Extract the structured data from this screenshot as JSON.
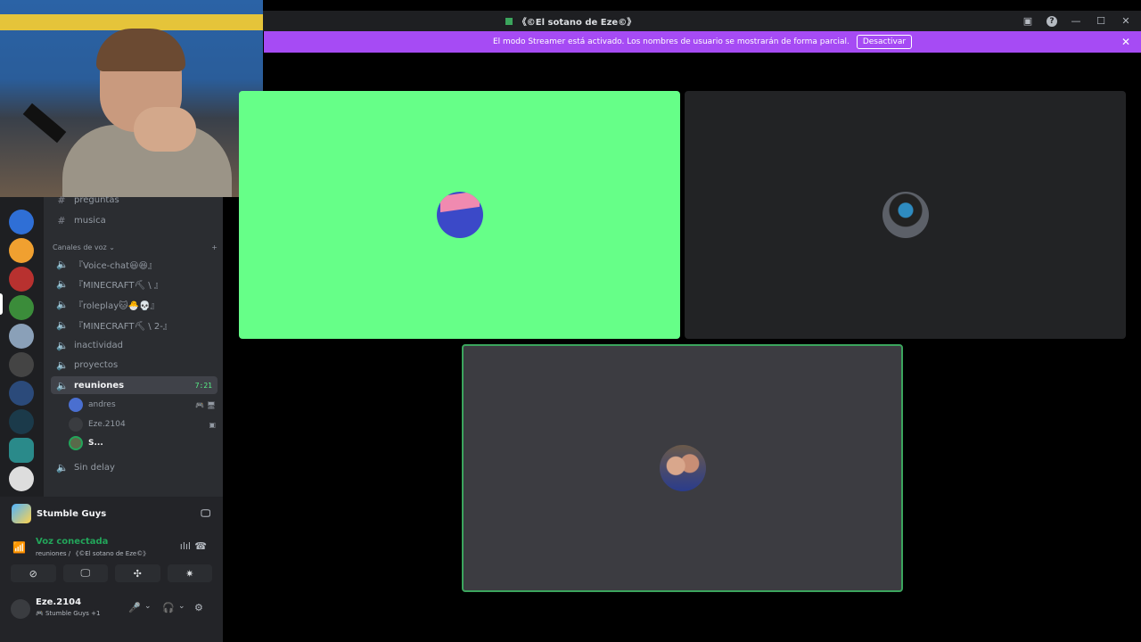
{
  "window": {
    "title": "《©El sotano de Eze©》"
  },
  "streamer_banner": {
    "text": "El modo Streamer está activado. Los nombres de usuario se mostrarán de forma parcial.",
    "button": "Desactivar"
  },
  "channels": {
    "text": [
      {
        "label": "preguntas",
        "icon": "hash-icon"
      },
      {
        "label": "musica",
        "icon": "hash-icon"
      }
    ],
    "voice_category": "Canales de voz",
    "voice": [
      {
        "label": "『Voice-chat😃😆』"
      },
      {
        "label": "『MINECRAFT⛏ \\ 』"
      },
      {
        "label": "『roleplay🐱🐣💀』"
      },
      {
        "label": "『MINECRAFT⛏ \\ 2-』"
      },
      {
        "label": "inactividad"
      },
      {
        "label": "proyectos"
      },
      {
        "label": "reuniones",
        "time": "7:21",
        "active": true
      },
      {
        "label": "Sin delay"
      }
    ],
    "voice_users": [
      {
        "name": "andres"
      },
      {
        "name": "Eze.2104"
      },
      {
        "name": "S..."
      }
    ]
  },
  "activity": {
    "game": "Stumble Guys"
  },
  "voice_status": {
    "state": "Voz conectada",
    "location": "reuniones / 《©El sotano de Eze©》"
  },
  "user": {
    "name": "Eze.2104",
    "status": "🎮 Stumble Guys +1"
  },
  "colors": {
    "accent": "#a64bf4",
    "connected": "#23a55a",
    "speaking_border": "#3ba55d",
    "tile_green": "#66ff88"
  }
}
